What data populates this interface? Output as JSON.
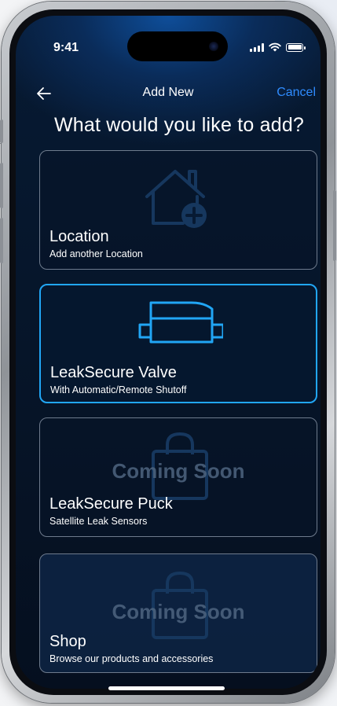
{
  "status_bar": {
    "time": "9:41"
  },
  "nav": {
    "title": "Add New",
    "cancel_label": "Cancel"
  },
  "heading": "What would you like to add?",
  "options": [
    {
      "title": "Location",
      "subtitle": "Add another Location",
      "icon": "house-add-icon",
      "selected": false
    },
    {
      "title": "LeakSecure Valve",
      "subtitle": "With Automatic/Remote Shutoff",
      "icon": "valve-icon",
      "selected": true
    },
    {
      "title": "LeakSecure Puck",
      "subtitle": "Satellite Leak Sensors",
      "icon": "shopping-bag-icon",
      "badge": "Coming Soon"
    },
    {
      "title": "Shop",
      "subtitle": "Browse our products and accessories",
      "icon": "shopping-bag-icon",
      "badge": "Coming Soon"
    }
  ],
  "colors": {
    "accent": "#21a6f5",
    "link": "#2f8cff",
    "background": "#061427"
  }
}
